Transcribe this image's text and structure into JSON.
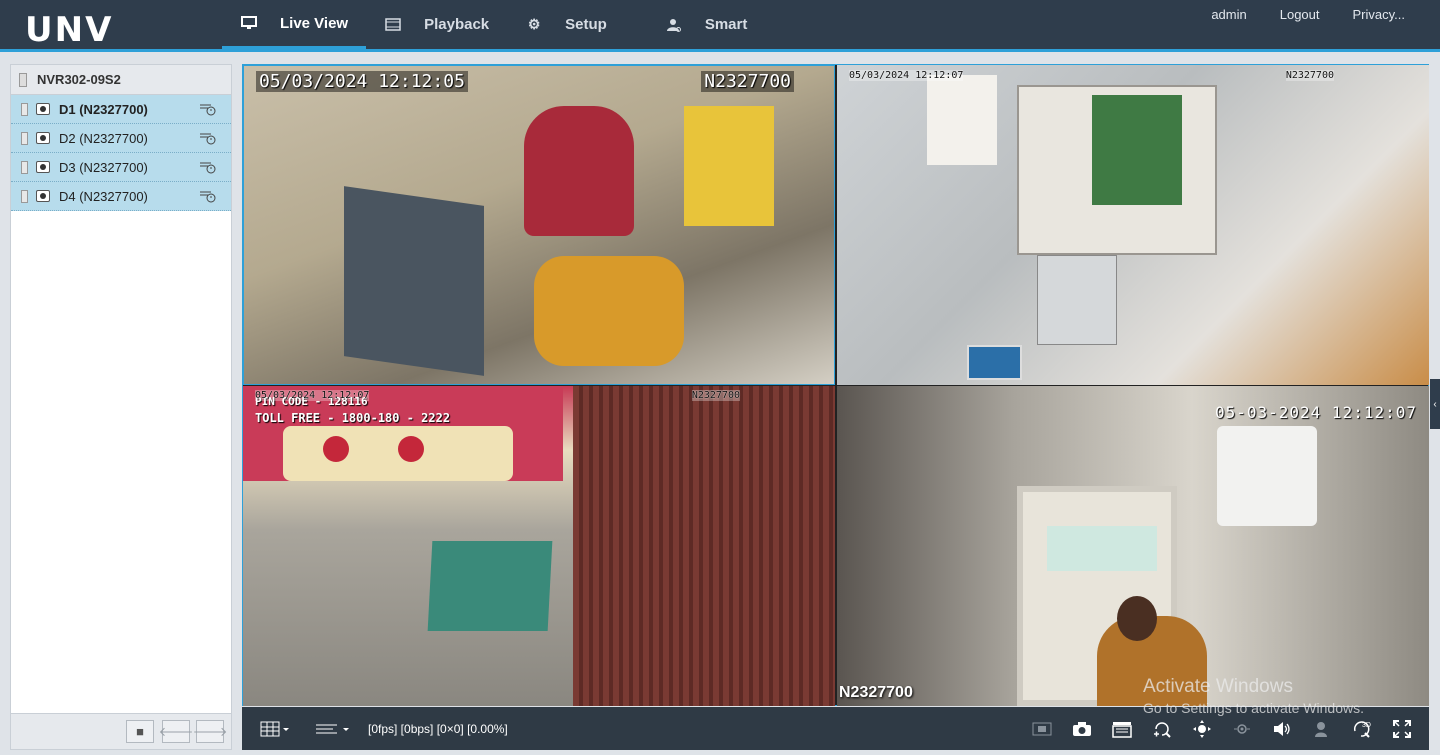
{
  "brand": {
    "logo": "UNV"
  },
  "nav": [
    {
      "label": "Live View",
      "icon": "monitor-icon",
      "active": true
    },
    {
      "label": "Playback",
      "icon": "film-icon",
      "active": false
    },
    {
      "label": "Setup",
      "icon": "gear-icon",
      "active": false
    },
    {
      "label": "Smart",
      "icon": "person-scan-icon",
      "active": false
    }
  ],
  "toplinks": {
    "user": "admin",
    "logout": "Logout",
    "privacy": "Privacy..."
  },
  "sidebar": {
    "device": "NVR302-09S2",
    "channels": [
      {
        "label": "D1 (N2327700)",
        "selected": true
      },
      {
        "label": "D2 (N2327700)",
        "selected": false
      },
      {
        "label": "D3 (N2327700)",
        "selected": false
      },
      {
        "label": "D4 (N2327700)",
        "selected": false
      }
    ]
  },
  "tiles": {
    "t1": {
      "time": "05/03/2024 12:12:05",
      "name": "N2327700"
    },
    "t2": {
      "time": "05/03/2024 12:12:07",
      "name": "N2327700"
    },
    "t3": {
      "time": "05/03/2024 12:12:07",
      "name": "N2327700",
      "sign1": "PIN CODE  -  128116",
      "sign2": "TOLL FREE - 1800-180 - 2222"
    },
    "t4": {
      "time": "05-03-2024 12:12:07",
      "name": "N2327700"
    }
  },
  "toolbar": {
    "status": "[0fps] [0bps] [0×0] [0.00%]"
  },
  "watermark": {
    "line1": "Activate Windows",
    "line2": "Go to Settings to activate Windows."
  },
  "colors": {
    "accent": "#2ea0d8",
    "topbar": "#2f3d4c",
    "selected_row": "#b7dcec"
  }
}
